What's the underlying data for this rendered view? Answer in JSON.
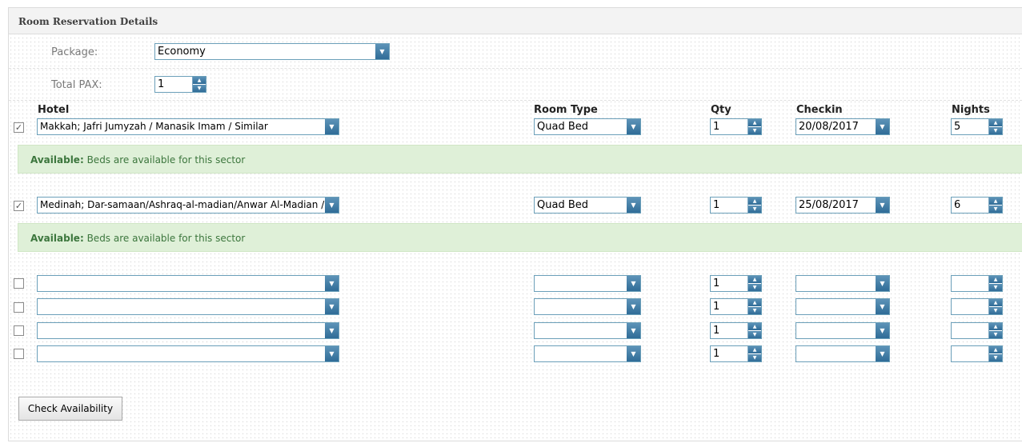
{
  "section_title": "Room Reservation Details",
  "form": {
    "package_label": "Package:",
    "package_value": "Economy",
    "total_pax_label": "Total PAX:",
    "total_pax_value": "1"
  },
  "columns": {
    "hotel": "Hotel",
    "room_type": "Room Type",
    "qty": "Qty",
    "checkin": "Checkin",
    "nights": "Nights"
  },
  "rows": [
    {
      "checked": "✓",
      "hotel": "Makkah; Jafri Jumyzah / Manasik Imam / Similar",
      "room_type": "Quad Bed",
      "qty": "1",
      "checkin": "20/08/2017",
      "nights": "5"
    },
    {
      "checked": "✓",
      "hotel": "Medinah; Dar-samaan/Ashraq-al-madian/Anwar Al-Madian /Sir",
      "room_type": "Quad Bed",
      "qty": "1",
      "checkin": "25/08/2017",
      "nights": "6"
    },
    {
      "checked": "",
      "hotel": "",
      "room_type": "",
      "qty": "1",
      "checkin": "",
      "nights": ""
    },
    {
      "checked": "",
      "hotel": "",
      "room_type": "",
      "qty": "1",
      "checkin": "",
      "nights": ""
    },
    {
      "checked": "",
      "hotel": "",
      "room_type": "",
      "qty": "1",
      "checkin": "",
      "nights": ""
    },
    {
      "checked": "",
      "hotel": "",
      "room_type": "",
      "qty": "1",
      "checkin": "",
      "nights": ""
    }
  ],
  "availability": [
    {
      "label": "Available:",
      "message": "Beds are available for this sector"
    },
    {
      "label": "Available:",
      "message": "Beds are available for this sector"
    }
  ],
  "check_button_label": "Check Availability",
  "icons": {
    "dropdown": "chevron-down-icon",
    "spinner": "spinner-arrows-icon",
    "checkbox": "check-icon"
  },
  "colors": {
    "control_border": "#6b9fb9",
    "button_blue": "#3b78a3",
    "available_bg": "#dff0d8",
    "available_text": "#3c763d"
  }
}
